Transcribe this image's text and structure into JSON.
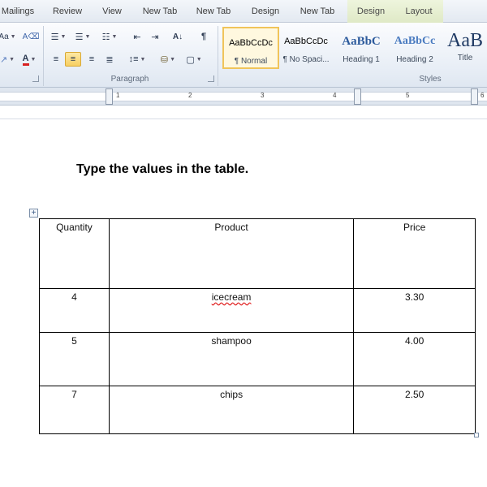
{
  "tabs": [
    "Mailings",
    "Review",
    "View",
    "New Tab",
    "New Tab",
    "Design",
    "New Tab",
    "Design",
    "Layout"
  ],
  "ribbon": {
    "font_partial": "Aa",
    "paragraph_label": "Paragraph",
    "styles_label": "Styles",
    "styles": [
      {
        "sample": "AaBbCcDc",
        "name": "¶ Normal"
      },
      {
        "sample": "AaBbCcDc",
        "name": "¶ No Spaci..."
      },
      {
        "sample": "AaBbC",
        "name": "Heading 1"
      },
      {
        "sample": "AaBbCc",
        "name": "Heading 2"
      },
      {
        "sample": "AaB",
        "name": "Title"
      }
    ]
  },
  "ruler": {
    "numbers": [
      "1",
      "2",
      "3",
      "4",
      "5",
      "6"
    ]
  },
  "document": {
    "heading": "Type the values in the table.",
    "table": {
      "headers": [
        "Quantity",
        "Product",
        "Price"
      ],
      "rows": [
        [
          "4",
          "icecream",
          "3.30"
        ],
        [
          "5",
          "shampoo",
          "4.00"
        ],
        [
          "7",
          "chips",
          "2.50"
        ]
      ]
    }
  },
  "colors": {
    "accent": "#f0c45a",
    "contextual_tab": "#dfe9c6",
    "spell_error": "#e02020"
  }
}
